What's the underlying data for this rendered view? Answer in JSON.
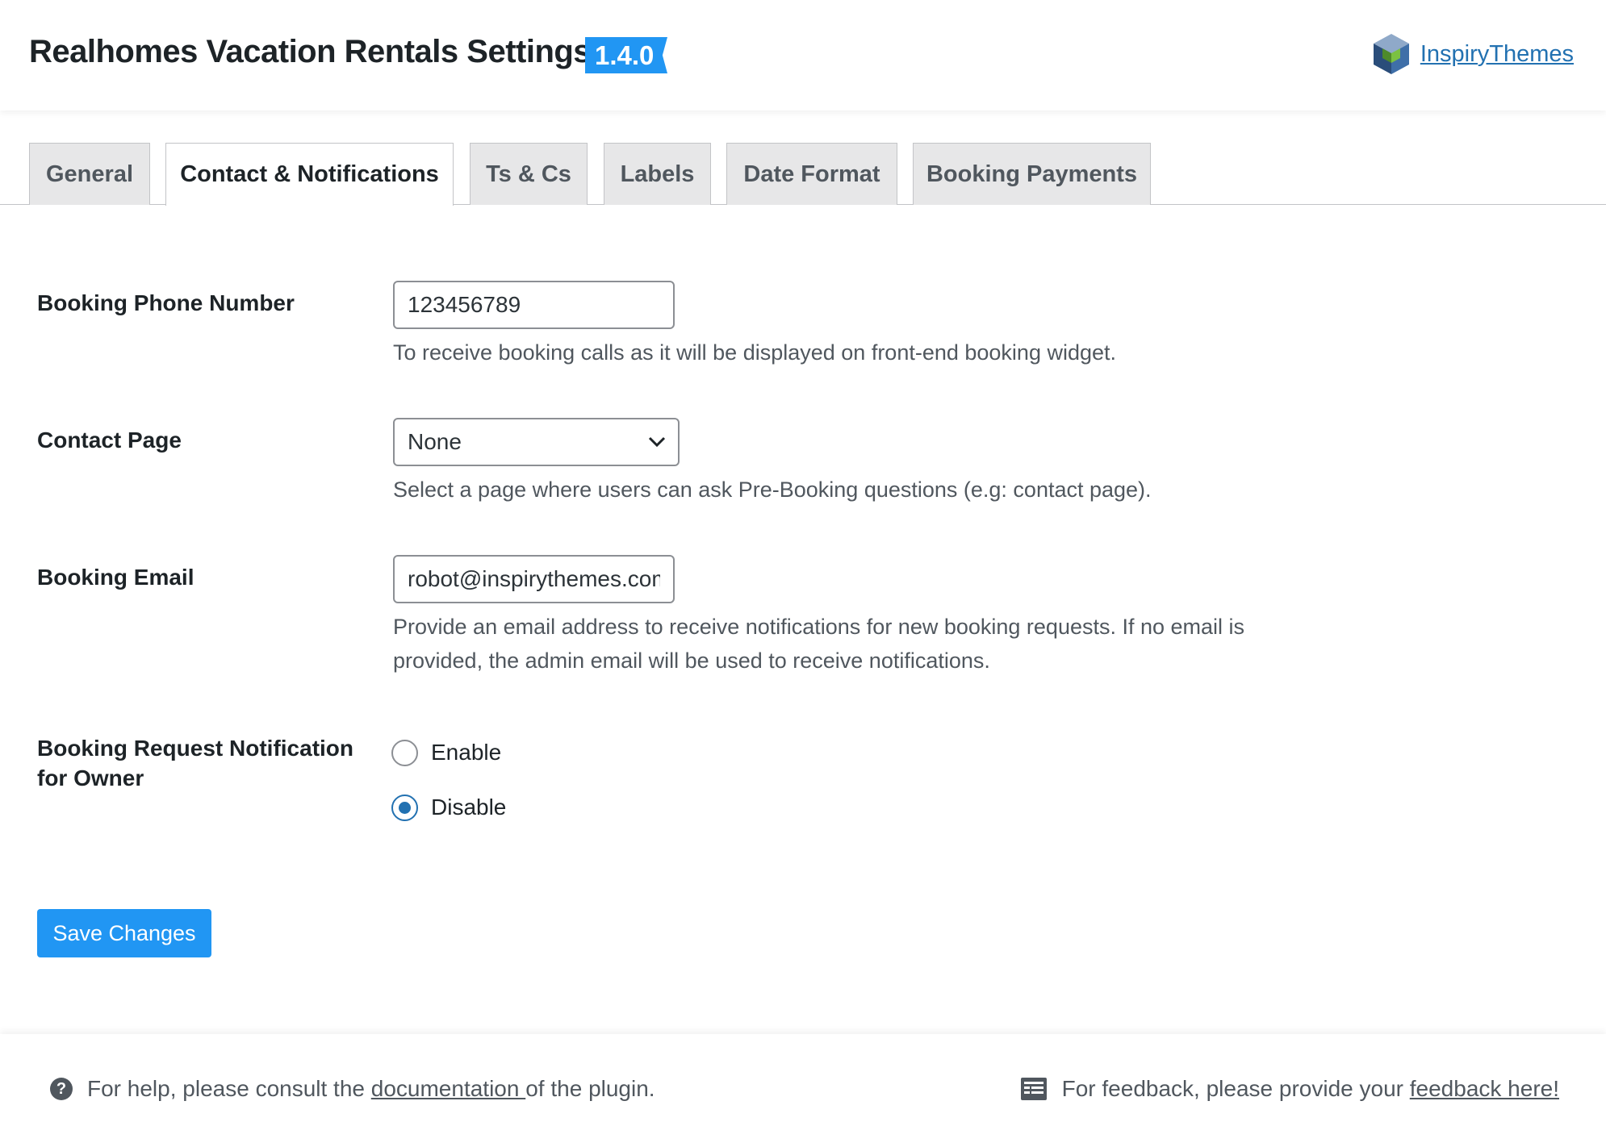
{
  "header": {
    "title": "Realhomes Vacation Rentals Settings",
    "version": "1.4.0",
    "brand_name": "InspiryThemes",
    "brand_icon": "cube-logo-icon",
    "accent_color": "#2196f3"
  },
  "tabs": [
    {
      "label": "General",
      "active": false
    },
    {
      "label": "Contact & Notifications",
      "active": true
    },
    {
      "label": "Ts & Cs",
      "active": false
    },
    {
      "label": "Labels",
      "active": false
    },
    {
      "label": "Date Format",
      "active": false
    },
    {
      "label": "Booking Payments",
      "active": false
    }
  ],
  "form": {
    "phone": {
      "label": "Booking Phone Number",
      "value": "123456789",
      "description": "To receive booking calls as it will be displayed on front-end booking widget."
    },
    "contact_page": {
      "label": "Contact Page",
      "selected": "None",
      "description": "Select a page where users can ask Pre-Booking questions (e.g: contact page)."
    },
    "email": {
      "label": "Booking Email",
      "value": "robot@inspirythemes.com",
      "description_line1": "Provide an email address to receive notifications for new booking requests. If no email is",
      "description_line2": "provided, the admin email will be used to receive notifications."
    },
    "owner_notification": {
      "label_line1": "Booking Request Notification",
      "label_line2": "for Owner",
      "options": [
        {
          "label": "Enable",
          "checked": false
        },
        {
          "label": "Disable",
          "checked": true
        }
      ]
    },
    "save_label": "Save Changes"
  },
  "footer": {
    "help_prefix": "For help, please consult the ",
    "help_link": "documentation ",
    "help_suffix": "of the plugin.",
    "feedback_prefix": "For feedback, please provide your ",
    "feedback_link": "feedback here!"
  }
}
